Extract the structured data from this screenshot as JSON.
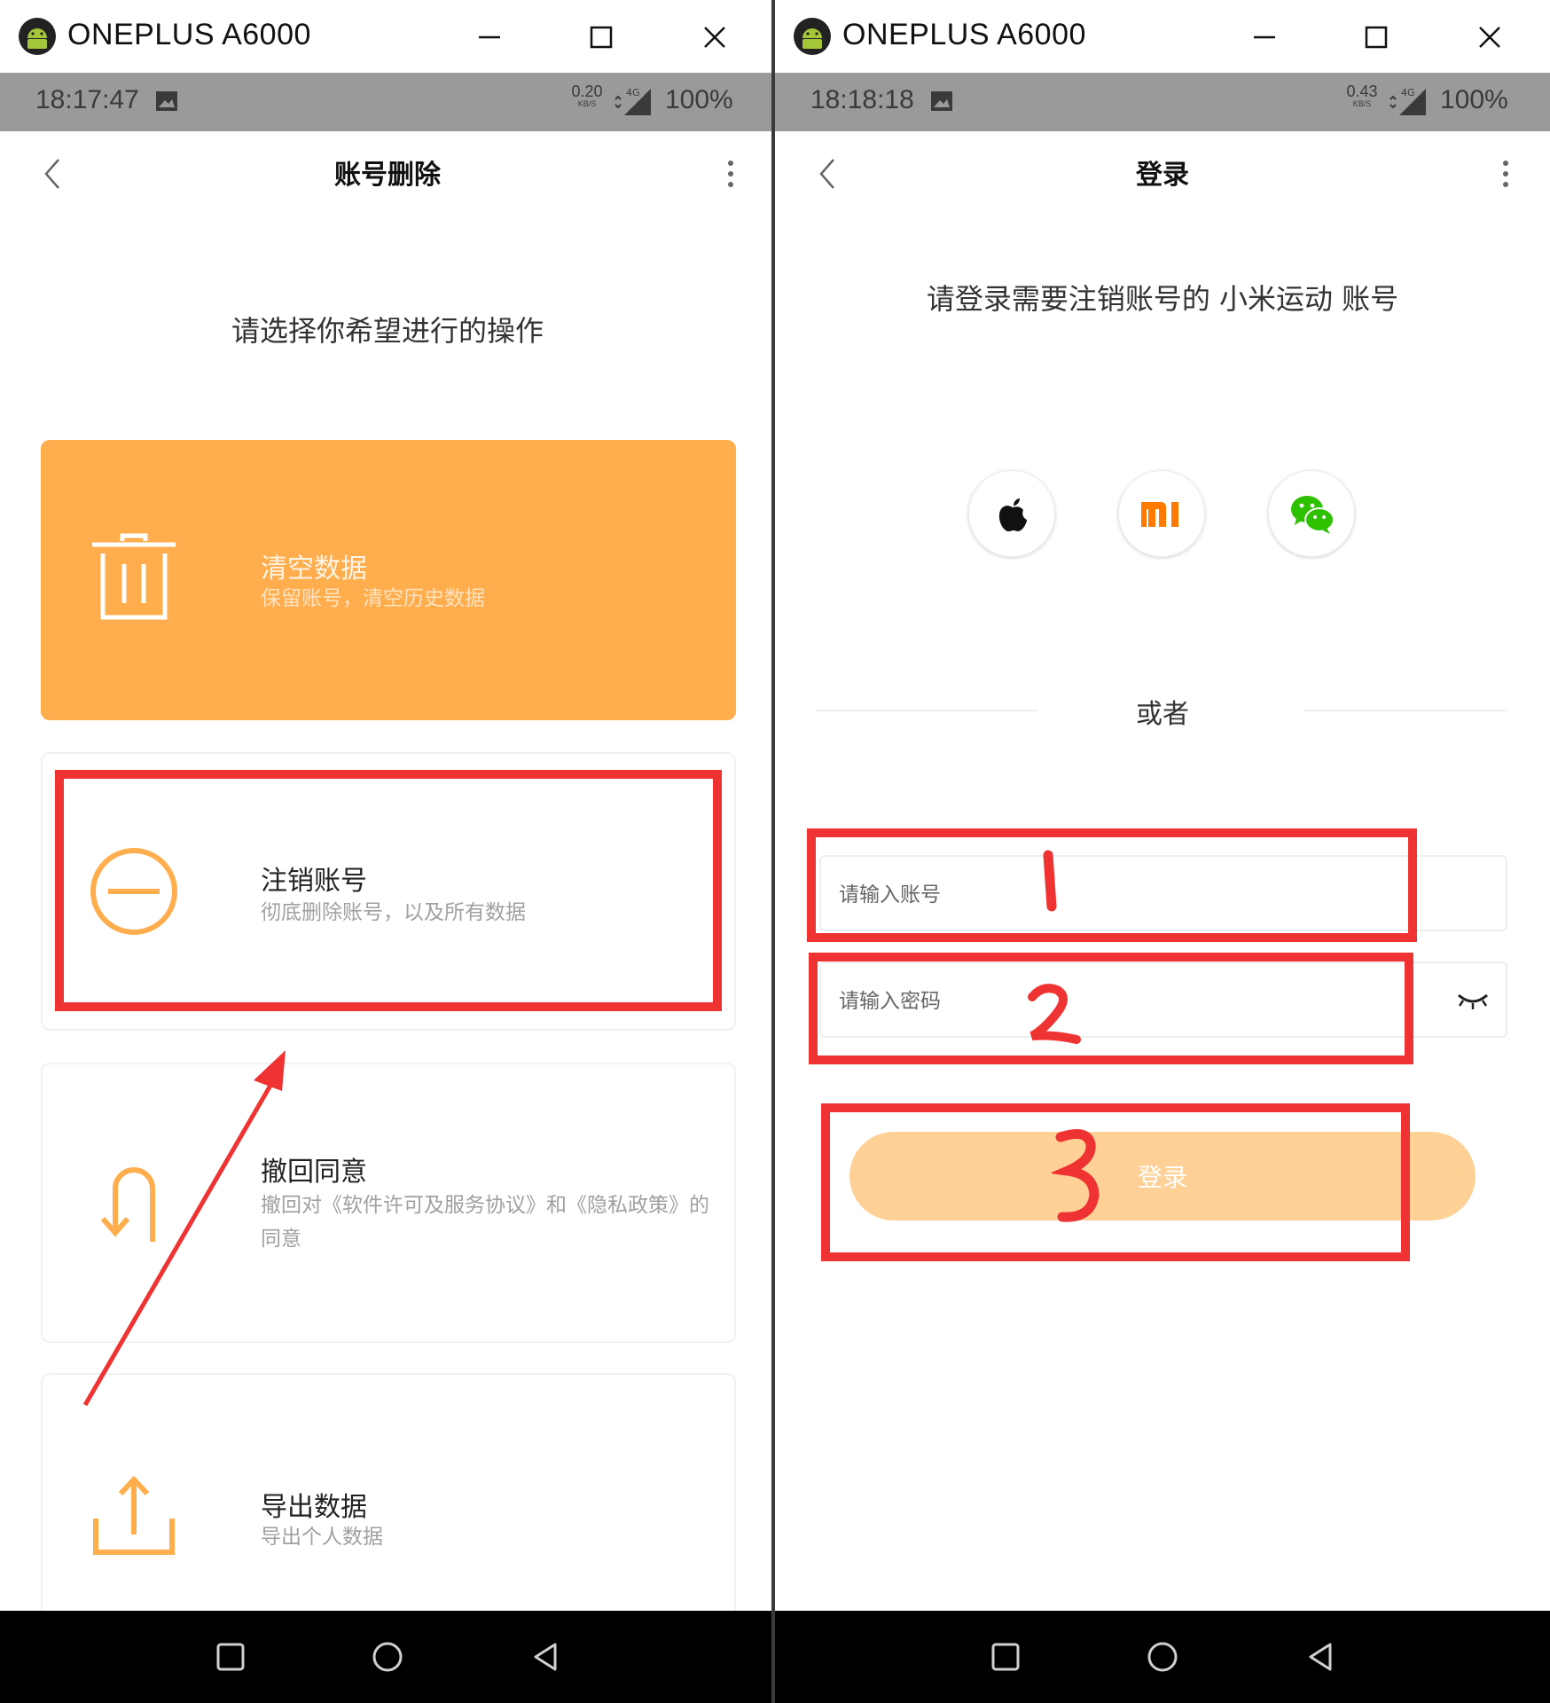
{
  "left": {
    "window": {
      "title": "ONEPLUS A6000"
    },
    "status": {
      "time": "18:17:47",
      "net_speed": "0.20",
      "net_unit": "KB/S",
      "network": "4G",
      "battery": "100%"
    },
    "header": {
      "title": "账号删除"
    },
    "prompt": "请选择你希望进行的操作",
    "cards": [
      {
        "title": "清空数据",
        "desc": "保留账号，清空历史数据",
        "icon": "trash-icon",
        "selected": true
      },
      {
        "title": "注销账号",
        "desc": "彻底删除账号，以及所有数据",
        "icon": "minus-circle-icon"
      },
      {
        "title": "撤回同意",
        "desc": "撤回对《软件许可及服务协议》和《隐私政策》的同意",
        "icon": "undo-arrow-icon"
      },
      {
        "title": "导出数据",
        "desc": "导出个人数据",
        "icon": "export-icon"
      }
    ]
  },
  "right": {
    "window": {
      "title": "ONEPLUS A6000"
    },
    "status": {
      "time": "18:18:18",
      "net_speed": "0.43",
      "net_unit": "KB/S",
      "network": "4G",
      "battery": "100%"
    },
    "header": {
      "title": "登录"
    },
    "prompt": "请登录需要注销账号的 小米运动 账号",
    "social": [
      "apple-icon",
      "mi-icon",
      "wechat-icon"
    ],
    "or": "或者",
    "account": {
      "value": "",
      "placeholder": "请输入账号"
    },
    "password": {
      "value": "",
      "placeholder": "请输入密码"
    },
    "login_button": "登录"
  },
  "annotations": {
    "color": "#ef3232",
    "steps": [
      "1",
      "2",
      "3"
    ]
  },
  "colors": {
    "accent": "#ffad4d",
    "login_button": "#ffd196",
    "status_bar": "#9a9a9a"
  }
}
